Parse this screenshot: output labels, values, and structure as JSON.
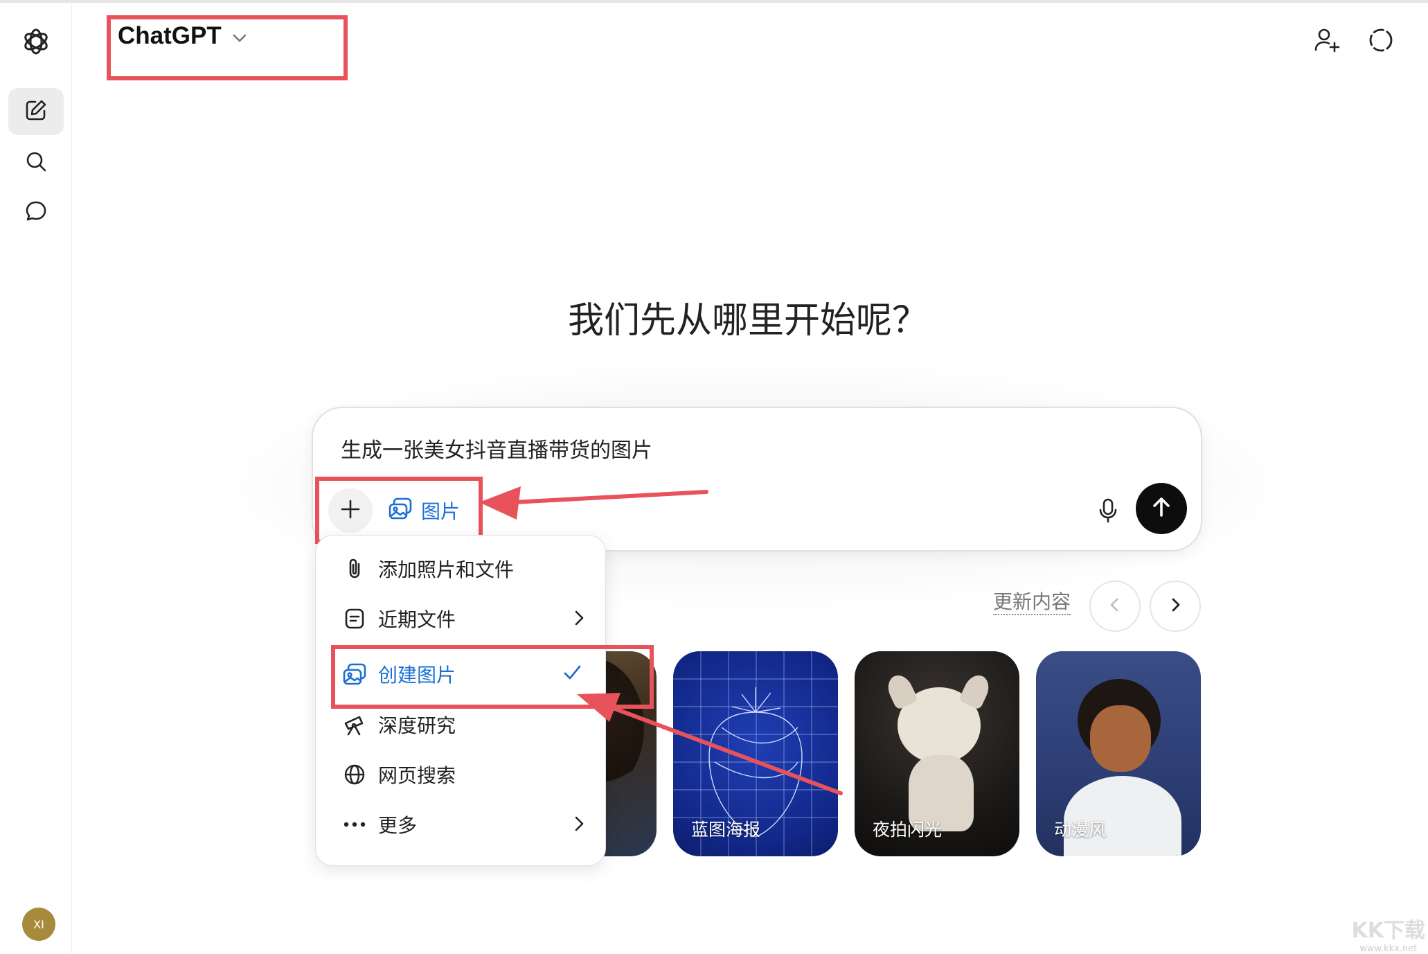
{
  "header": {
    "model_name": "ChatGPT"
  },
  "sidebar": {
    "avatar_initials": "XI"
  },
  "main": {
    "hero_title": "我们先从哪里开始呢？",
    "composer": {
      "text": "生成一张美女抖音直播带货的图片",
      "active_tool_label": "图片"
    }
  },
  "menu": {
    "items": [
      {
        "label": "添加照片和文件",
        "icon": "paperclip-icon"
      },
      {
        "label": "近期文件",
        "icon": "document-icon"
      },
      {
        "label": "创建图片",
        "icon": "image-icon"
      },
      {
        "label": "深度研究",
        "icon": "telescope-icon"
      },
      {
        "label": "网页搜索",
        "icon": "globe-icon"
      },
      {
        "label": "更多",
        "icon": "ellipsis-icon"
      }
    ]
  },
  "gallery": {
    "update_label": "更新内容",
    "cards": [
      {
        "label": ""
      },
      {
        "label": "蓝图海报"
      },
      {
        "label": "夜拍闪光"
      },
      {
        "label": "动漫风"
      }
    ]
  },
  "watermark": {
    "text": "KK下载",
    "url": "www.kkx.net"
  },
  "colors": {
    "accent": "#1a6fd4",
    "highlight_red": "#e8525a",
    "send_button": "#0d0d0d"
  }
}
